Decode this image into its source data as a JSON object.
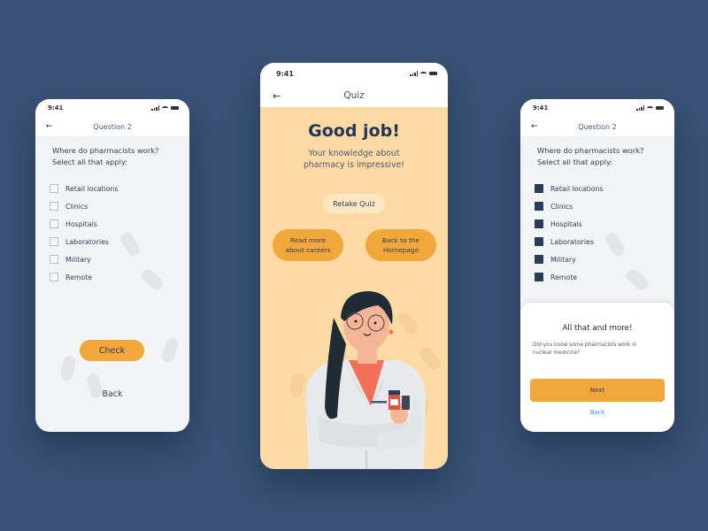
{
  "colors": {
    "background": "#3a5275",
    "accent": "#f2a73a",
    "primary_text": "#2d3e5c",
    "center_screen_bg": "#fddaa3",
    "link": "#3b8fe0"
  },
  "left_screen": {
    "status_time": "9:41",
    "nav_title": "Question 2",
    "back_icon": "arrow-left-icon",
    "question_line1": "Where do pharmacists work?",
    "question_line2": "Select all that apply:",
    "options": [
      {
        "label": "Retail locations",
        "checked": false
      },
      {
        "label": "Clinics",
        "checked": false
      },
      {
        "label": "Hospitals",
        "checked": false
      },
      {
        "label": "Laboratories",
        "checked": false
      },
      {
        "label": "Military",
        "checked": false
      },
      {
        "label": "Remote",
        "checked": false
      }
    ],
    "check_button": "Check",
    "back_link": "Back"
  },
  "center_screen": {
    "status_time": "9:41",
    "nav_title": "Quiz",
    "back_icon": "arrow-left-icon",
    "headline": "Good job!",
    "subtext_line1": "Your knowledge about",
    "subtext_line2": "pharmacy is impressive!",
    "retake_button": "Retake Quiz",
    "read_more_line1": "Read more",
    "read_more_line2": "about careers",
    "homepage_line1": "Back to the",
    "homepage_line2": "Homepage",
    "illustration": "pharmacist-illustration"
  },
  "right_screen": {
    "status_time": "9:41",
    "nav_title": "Question 2",
    "back_icon": "arrow-left-icon",
    "question_line1": "Where do pharmacists work?",
    "question_line2": "Select all that apply:",
    "options": [
      {
        "label": "Retail locations",
        "checked": true
      },
      {
        "label": "Clinics",
        "checked": true
      },
      {
        "label": "Hospitals",
        "checked": true
      },
      {
        "label": "Laboratories",
        "checked": true
      },
      {
        "label": "Military",
        "checked": true
      },
      {
        "label": "Remote",
        "checked": true
      }
    ],
    "sheet": {
      "title": "All that and more!",
      "body_line1": "Did you know some pharmacists work in",
      "body_line2": "nuclear medicine?",
      "next_button": "Next",
      "back_link": "Back"
    }
  }
}
